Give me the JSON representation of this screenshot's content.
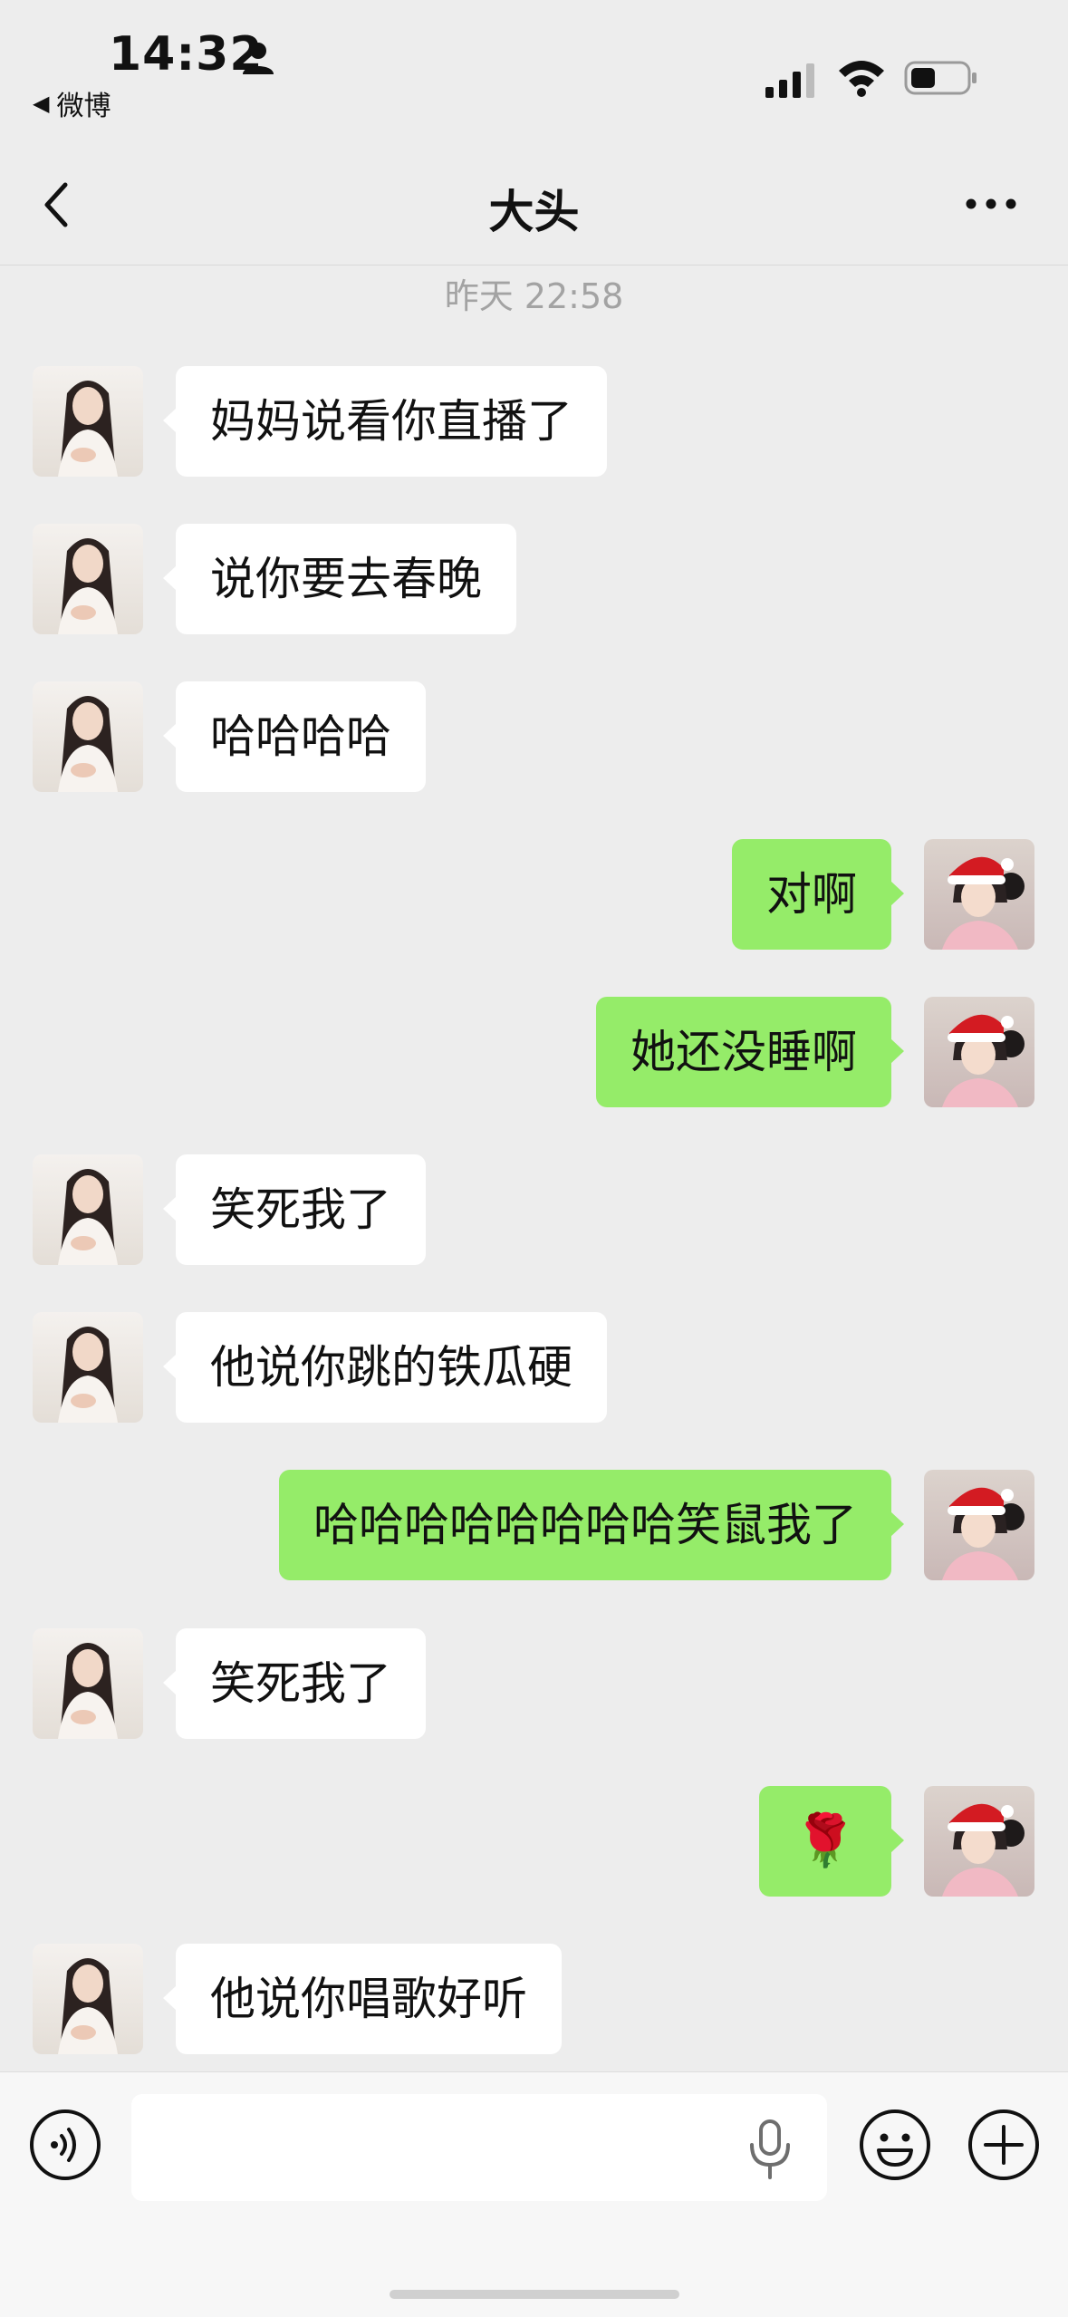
{
  "status_bar": {
    "time": "14:32",
    "back_app_label": "微博"
  },
  "nav": {
    "title": "大头"
  },
  "timestamp": "昨天 22:58",
  "messages": [
    {
      "side": "left",
      "text": "妈妈说看你直播了"
    },
    {
      "side": "left",
      "text": "说你要去春晚"
    },
    {
      "side": "left",
      "text": "哈哈哈哈"
    },
    {
      "side": "right",
      "text": "对啊"
    },
    {
      "side": "right",
      "text": "她还没睡啊"
    },
    {
      "side": "left",
      "text": "笑死我了"
    },
    {
      "side": "left",
      "text": "他说你跳的铁瓜硬"
    },
    {
      "side": "right",
      "text": "哈哈哈哈哈哈哈哈笑鼠我了"
    },
    {
      "side": "left",
      "text": "笑死我了"
    },
    {
      "side": "right",
      "text": "🌹"
    },
    {
      "side": "left",
      "text": "他说你唱歌好听"
    }
  ],
  "colors": {
    "sent_bubble": "#95ec69",
    "received_bubble": "#ffffff",
    "background": "#ededed"
  },
  "icons": {
    "status": [
      "person-icon",
      "signal-icon",
      "wifi-icon",
      "battery-icon"
    ],
    "nav": [
      "back-chevron-icon",
      "more-icon"
    ],
    "input": [
      "voice-icon",
      "mic-icon",
      "emoji-icon",
      "plus-icon"
    ]
  }
}
